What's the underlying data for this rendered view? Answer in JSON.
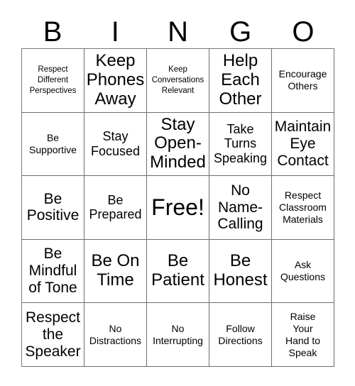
{
  "card": {
    "title_letters": [
      "B",
      "I",
      "N",
      "G",
      "O"
    ],
    "grid_size": "5x5",
    "rows": [
      [
        {
          "text": "Respect\nDifferent\nPerspectives",
          "size": "xs"
        },
        {
          "text": "Keep\nPhones\nAway",
          "size": "xl"
        },
        {
          "text": "Keep\nConversations\nRelevant",
          "size": "xs"
        },
        {
          "text": "Help\nEach\nOther",
          "size": "xl"
        },
        {
          "text": "Encourage\nOthers",
          "size": "sm"
        }
      ],
      [
        {
          "text": "Be\nSupportive",
          "size": "sm"
        },
        {
          "text": "Stay\nFocused",
          "size": "md"
        },
        {
          "text": "Stay\nOpen-\nMinded",
          "size": "xl"
        },
        {
          "text": "Take\nTurns\nSpeaking",
          "size": "md"
        },
        {
          "text": "Maintain\nEye\nContact",
          "size": "lg"
        }
      ],
      [
        {
          "text": "Be\nPositive",
          "size": "lg"
        },
        {
          "text": "Be\nPrepared",
          "size": "md"
        },
        {
          "text": "Free!",
          "size": "free"
        },
        {
          "text": "No\nName-\nCalling",
          "size": "lg"
        },
        {
          "text": "Respect\nClassroom\nMaterials",
          "size": "sm"
        }
      ],
      [
        {
          "text": "Be\nMindful\nof Tone",
          "size": "lg"
        },
        {
          "text": "Be On\nTime",
          "size": "xl"
        },
        {
          "text": "Be\nPatient",
          "size": "xl"
        },
        {
          "text": "Be\nHonest",
          "size": "xl"
        },
        {
          "text": "Ask\nQuestions",
          "size": "sm"
        }
      ],
      [
        {
          "text": "Respect\nthe\nSpeaker",
          "size": "lg"
        },
        {
          "text": "No\nDistractions",
          "size": "sm"
        },
        {
          "text": "No\nInterrupting",
          "size": "sm"
        },
        {
          "text": "Follow\nDirections",
          "size": "sm"
        },
        {
          "text": "Raise\nYour\nHand to\nSpeak",
          "size": "sm"
        }
      ]
    ]
  },
  "colors": {
    "background": "#ffffff",
    "text": "#000000",
    "grid_line": "#6e6e6e"
  }
}
